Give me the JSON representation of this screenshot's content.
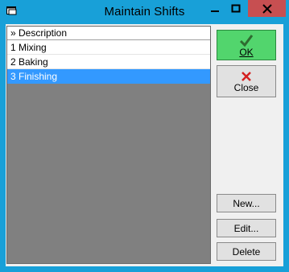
{
  "window": {
    "title": "Maintain Shifts",
    "colors": {
      "titlebar": "#18a0d8",
      "close": "#c74f51",
      "ok": "#52d56d",
      "selection": "#3399ff"
    }
  },
  "list": {
    "header": "» Description",
    "rows": [
      "1 Mixing",
      "2 Baking",
      "3 Finishing"
    ],
    "selected_index": 2
  },
  "buttons": {
    "ok": {
      "label": "OK",
      "icon": "checkmark-icon"
    },
    "close": {
      "label": "Close",
      "icon": "x-icon"
    },
    "new": "New...",
    "edit": "Edit...",
    "delete": "Delete"
  }
}
